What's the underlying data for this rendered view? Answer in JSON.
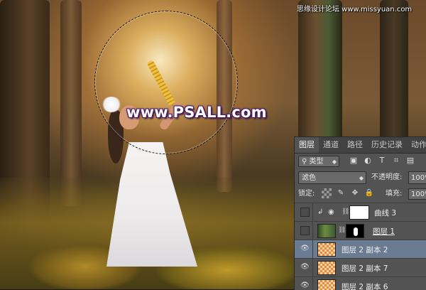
{
  "watermark": "www.PSALL.com",
  "site_mark": "思缘设计论坛 www.missyuan.com",
  "panel": {
    "tabs": [
      "图层",
      "通道",
      "路径",
      "历史记录",
      "动作"
    ],
    "filter_label": "类型",
    "filter_icons": [
      "image-filter-icon",
      "adjustment-filter-icon",
      "text-filter-icon",
      "shape-filter-icon",
      "smart-object-filter-icon"
    ],
    "blend_mode": "滤色",
    "opacity_label": "不透明度:",
    "opacity_value": "100%",
    "lock_label": "锁定:",
    "fill_label": "填充:",
    "fill_value": "100%",
    "layers": [
      {
        "name": "曲线 3",
        "visible": false,
        "selected": false
      },
      {
        "name": "图层 1",
        "visible": false,
        "selected": false
      },
      {
        "name": "图层 2 副本 2",
        "visible": true,
        "selected": true
      },
      {
        "name": "图层 2 副本 7",
        "visible": true,
        "selected": false
      },
      {
        "name": "图层 2 副本 6",
        "visible": true,
        "selected": false
      }
    ]
  }
}
